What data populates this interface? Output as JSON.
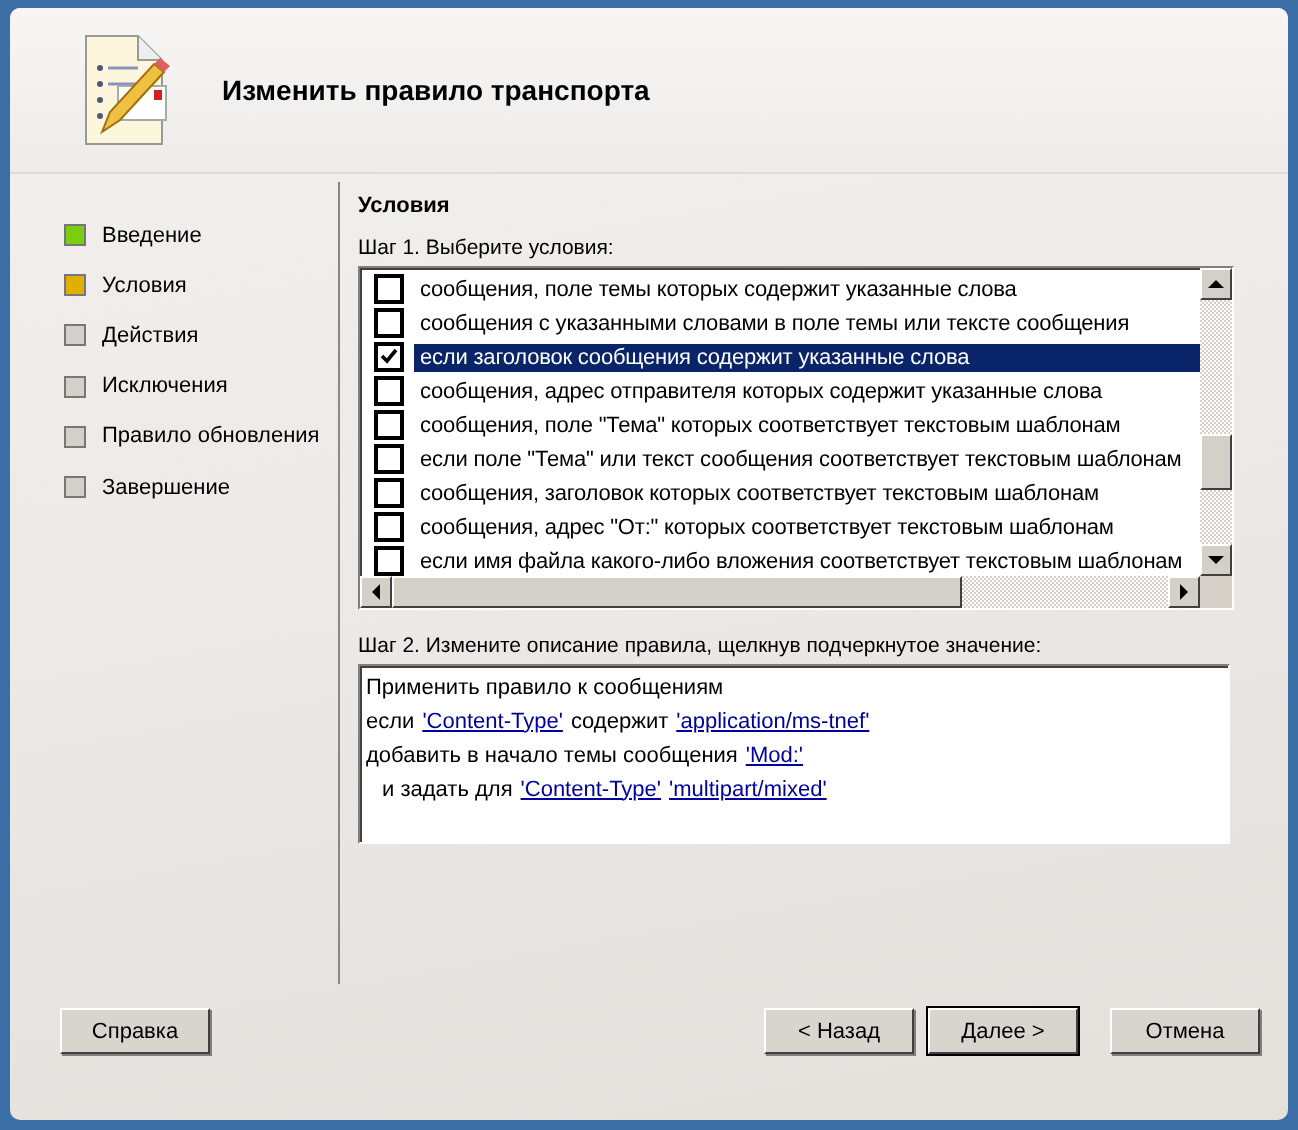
{
  "window": {
    "title": "Изменить правило транспорта"
  },
  "steps": [
    {
      "label": "Введение",
      "color": "#7ccc10"
    },
    {
      "label": "Условия",
      "color": "#e0b000"
    },
    {
      "label": "Действия",
      "color": "#d4d0c8"
    },
    {
      "label": "Исключения",
      "color": "#d4d0c8"
    },
    {
      "label": "Правило обновления",
      "color": "#d4d0c8"
    },
    {
      "label": "Завершение",
      "color": "#d4d0c8"
    }
  ],
  "section_title": "Условия",
  "step1_label": "Шаг 1. Выберите условия:",
  "conditions": [
    {
      "text": "сообщения, поле темы которых содержит указанные слова",
      "checked": false,
      "selected": false
    },
    {
      "text": "сообщения с указанными словами в поле темы или тексте сообщения",
      "checked": false,
      "selected": false
    },
    {
      "text": "если заголовок сообщения содержит указанные слова",
      "checked": true,
      "selected": true
    },
    {
      "text": "сообщения, адрес отправителя которых содержит указанные слова",
      "checked": false,
      "selected": false
    },
    {
      "text": "сообщения, поле \"Тема\" которых соответствует текстовым шаблонам",
      "checked": false,
      "selected": false
    },
    {
      "text": "если поле \"Тема\" или текст сообщения соответствует текстовым шаблонам",
      "checked": false,
      "selected": false
    },
    {
      "text": "сообщения, заголовок которых соответствует текстовым шаблонам",
      "checked": false,
      "selected": false
    },
    {
      "text": "сообщения, адрес \"От:\" которых соответствует текстовым шаблонам",
      "checked": false,
      "selected": false
    },
    {
      "text": "если имя файла какого-либо вложения соответствует текстовым шаблонам",
      "checked": false,
      "selected": false
    }
  ],
  "step2_label": "Шаг 2. Измените описание правила, щелкнув подчеркнутое значение:",
  "description": [
    {
      "indented": false,
      "parts": [
        {
          "kind": "text",
          "text": "Применить правило к сообщениям"
        }
      ]
    },
    {
      "indented": false,
      "parts": [
        {
          "kind": "text",
          "text": "если"
        },
        {
          "kind": "link",
          "text": "'Content-Type'"
        },
        {
          "kind": "text",
          "text": "содержит"
        },
        {
          "kind": "link",
          "text": "'application/ms-tnef'"
        }
      ]
    },
    {
      "indented": false,
      "parts": [
        {
          "kind": "text",
          "text": "добавить в начало темы сообщения"
        },
        {
          "kind": "link",
          "text": "'Mod:'"
        }
      ]
    },
    {
      "indented": true,
      "parts": [
        {
          "kind": "text",
          "text": "и задать для"
        },
        {
          "kind": "link",
          "text": "'Content-Type'"
        },
        {
          "kind": "link",
          "text": "'multipart/mixed'"
        }
      ]
    }
  ],
  "buttons": {
    "help": "Справка",
    "back": "< Назад",
    "next": "Далее >",
    "cancel": "Отмена"
  }
}
